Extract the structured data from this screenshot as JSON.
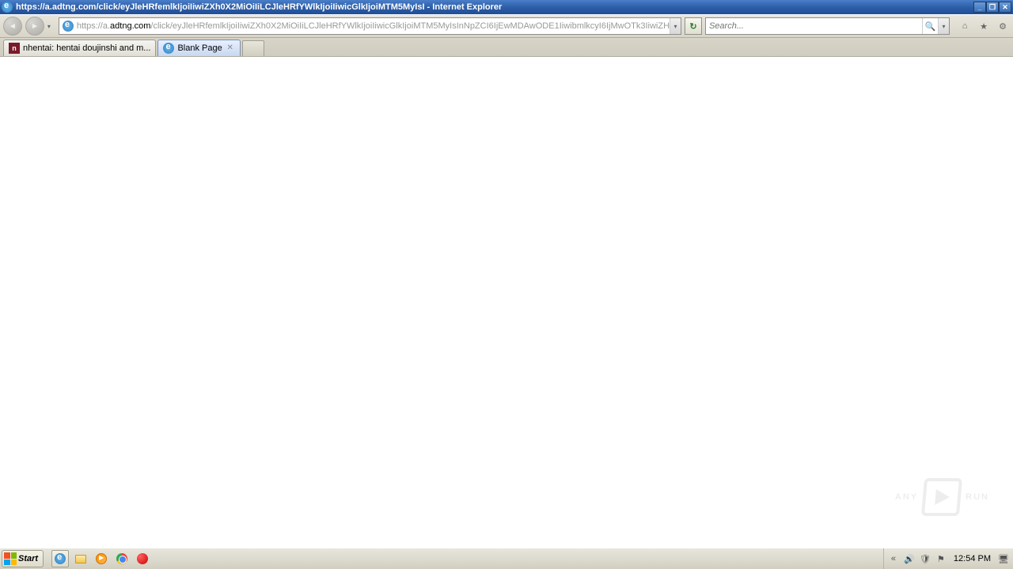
{
  "window": {
    "title": "https://a.adtng.com/click/eyJleHRfemlkIjoiIiwiZXh0X2MiOiIiLCJleHRfYWlkIjoiIiwicGlkIjoiMTM5MyIsI - Internet Explorer"
  },
  "address": {
    "prefix": "https://a.",
    "domain": "adtng.com",
    "path": "/click/eyJleHRfemlkIjoiIiwiZXh0X2MiOiIiLCJleHRfYWlkIjoiIiwicGlkIjoiMTM5MyIsInNpZCI6IjEwMDAwODE1IiwibmlkcyI6IjMwOTk3IiwiZH"
  },
  "search": {
    "placeholder": "Search..."
  },
  "tabs": [
    {
      "label": "nhentai: hentai doujinshi and m...",
      "active": false,
      "icon": "fav-red"
    },
    {
      "label": "Blank Page",
      "active": true,
      "icon": "ie"
    }
  ],
  "watermark": {
    "left": "ANY",
    "right": "RUN"
  },
  "taskbar": {
    "start": "Start",
    "clock": "12:54 PM"
  }
}
